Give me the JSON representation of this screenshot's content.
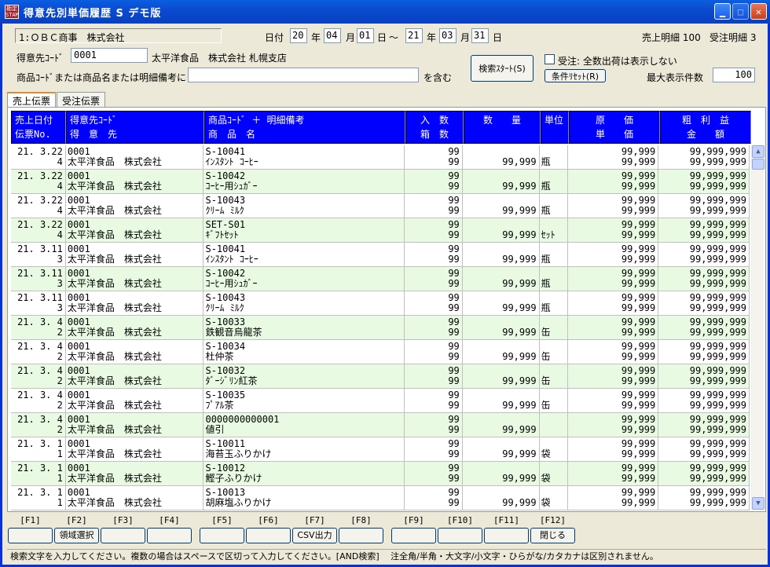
{
  "window": {
    "title": "得意先別単価履歴 S デモ版",
    "icon_text": "勘定 STAMP"
  },
  "header": {
    "company": "1:ＯＢＣ商事　株式会社",
    "date_label": "日付",
    "from_year": "20",
    "year_label": "年",
    "from_month": "04",
    "month_label": "月",
    "from_day": "01",
    "day_label": "日",
    "tilde": "～",
    "to_year": "21",
    "to_month": "03",
    "to_day": "31",
    "sales_detail": "売上明細 100",
    "order_detail": "受注明細 3",
    "customer_code_label": "得意先ｺｰﾄﾞ",
    "customer_code": "0001",
    "customer_name": "太平洋食品　株式会社 札幌支店",
    "search_label": "商品ｺｰﾄﾞまたは商品名または明細備考に",
    "search_value": "",
    "contains_label": "を含む",
    "search_button": "検索ｽﾀｰﾄ(S)",
    "order_checkbox_label": "受注: 全数出荷は表示しない",
    "reset_button": "条件ﾘｾｯﾄ(R)",
    "max_label": "最大表示件数",
    "max_value": "100"
  },
  "tabs": [
    "売上伝票",
    "受注伝票"
  ],
  "columns": [
    {
      "l1": "売上日付",
      "l2": "伝票No."
    },
    {
      "l1": "得意先ｺｰﾄﾞ",
      "l2": "得　意　先"
    },
    {
      "l1": "商品ｺｰﾄﾞ ＋ 明細備考",
      "l2": "商　品　名"
    },
    {
      "l1": "入　数",
      "l2": "箱　数"
    },
    {
      "l1": "",
      "l2": "数　　量"
    },
    {
      "l1": "",
      "l2": "単位"
    },
    {
      "l1": "原　　価",
      "l2": "単　　価"
    },
    {
      "l1": "粗　利　益",
      "l2": "金　　額"
    }
  ],
  "rows": [
    {
      "date": "21. 3.22",
      "no": "4",
      "code": "0001",
      "cust": "太平洋食品　株式会社",
      "pcode": "S-10041",
      "pname": "ｲﾝｽﾀﾝﾄ ｺｰﾋｰ",
      "irisu": "99",
      "hako": "99",
      "qty": "99,999",
      "unit": "瓶",
      "cost": "99,999",
      "price": "99,999",
      "profit": "99,999,999",
      "amount": "99,999,999"
    },
    {
      "date": "21. 3.22",
      "no": "4",
      "code": "0001",
      "cust": "太平洋食品　株式会社",
      "pcode": "S-10042",
      "pname": "ｺｰﾋｰ用ｼｭｶﾞｰ",
      "irisu": "99",
      "hako": "99",
      "qty": "99,999",
      "unit": "瓶",
      "cost": "99,999",
      "price": "99,999",
      "profit": "99,999,999",
      "amount": "99,999,999"
    },
    {
      "date": "21. 3.22",
      "no": "4",
      "code": "0001",
      "cust": "太平洋食品　株式会社",
      "pcode": "S-10043",
      "pname": "ｸﾘｰﾑ ﾐﾙｸ",
      "irisu": "99",
      "hako": "99",
      "qty": "99,999",
      "unit": "瓶",
      "cost": "99,999",
      "price": "99,999",
      "profit": "99,999,999",
      "amount": "99,999,999"
    },
    {
      "date": "21. 3.22",
      "no": "4",
      "code": "0001",
      "cust": "太平洋食品　株式会社",
      "pcode": "SET-S01",
      "pname": "ｷﾞﾌﾄｾｯﾄ",
      "irisu": "99",
      "hako": "99",
      "qty": "99,999",
      "unit": "ｾｯﾄ",
      "cost": "99,999",
      "price": "99,999",
      "profit": "99,999,999",
      "amount": "99,999,999"
    },
    {
      "date": "21. 3.11",
      "no": "3",
      "code": "0001",
      "cust": "太平洋食品　株式会社",
      "pcode": "S-10041",
      "pname": "ｲﾝｽﾀﾝﾄ ｺｰﾋｰ",
      "irisu": "99",
      "hako": "99",
      "qty": "99,999",
      "unit": "瓶",
      "cost": "99,999",
      "price": "99,999",
      "profit": "99,999,999",
      "amount": "99,999,999"
    },
    {
      "date": "21. 3.11",
      "no": "3",
      "code": "0001",
      "cust": "太平洋食品　株式会社",
      "pcode": "S-10042",
      "pname": "ｺｰﾋｰ用ｼｭｶﾞｰ",
      "irisu": "99",
      "hako": "99",
      "qty": "99,999",
      "unit": "瓶",
      "cost": "99,999",
      "price": "99,999",
      "profit": "99,999,999",
      "amount": "99,999,999"
    },
    {
      "date": "21. 3.11",
      "no": "3",
      "code": "0001",
      "cust": "太平洋食品　株式会社",
      "pcode": "S-10043",
      "pname": "ｸﾘｰﾑ ﾐﾙｸ",
      "irisu": "99",
      "hako": "99",
      "qty": "99,999",
      "unit": "瓶",
      "cost": "99,999",
      "price": "99,999",
      "profit": "99,999,999",
      "amount": "99,999,999"
    },
    {
      "date": "21. 3. 4",
      "no": "2",
      "code": "0001",
      "cust": "太平洋食品　株式会社",
      "pcode": "S-10033",
      "pname": "鉄観音烏龍茶",
      "irisu": "99",
      "hako": "99",
      "qty": "99,999",
      "unit": "缶",
      "cost": "99,999",
      "price": "99,999",
      "profit": "99,999,999",
      "amount": "99,999,999"
    },
    {
      "date": "21. 3. 4",
      "no": "2",
      "code": "0001",
      "cust": "太平洋食品　株式会社",
      "pcode": "S-10034",
      "pname": "杜仲茶",
      "irisu": "99",
      "hako": "99",
      "qty": "99,999",
      "unit": "缶",
      "cost": "99,999",
      "price": "99,999",
      "profit": "99,999,999",
      "amount": "99,999,999"
    },
    {
      "date": "21. 3. 4",
      "no": "2",
      "code": "0001",
      "cust": "太平洋食品　株式会社",
      "pcode": "S-10032",
      "pname": "ﾀﾞｰｼﾞﾘﾝ紅茶",
      "irisu": "99",
      "hako": "99",
      "qty": "99,999",
      "unit": "缶",
      "cost": "99,999",
      "price": "99,999",
      "profit": "99,999,999",
      "amount": "99,999,999"
    },
    {
      "date": "21. 3. 4",
      "no": "2",
      "code": "0001",
      "cust": "太平洋食品　株式会社",
      "pcode": "S-10035",
      "pname": "ﾌﾟｱﾙ茶",
      "irisu": "99",
      "hako": "99",
      "qty": "99,999",
      "unit": "缶",
      "cost": "99,999",
      "price": "99,999",
      "profit": "99,999,999",
      "amount": "99,999,999"
    },
    {
      "date": "21. 3. 4",
      "no": "2",
      "code": "0001",
      "cust": "太平洋食品　株式会社",
      "pcode": "0000000000001",
      "pname": "値引",
      "irisu": "99",
      "hako": "99",
      "qty": "99,999",
      "unit": "",
      "cost": "99,999",
      "price": "99,999",
      "profit": "99,999,999",
      "amount": "99,999,999"
    },
    {
      "date": "21. 3. 1",
      "no": "1",
      "code": "0001",
      "cust": "太平洋食品　株式会社",
      "pcode": "S-10011",
      "pname": "海苔玉ふりかけ",
      "irisu": "99",
      "hako": "99",
      "qty": "99,999",
      "unit": "袋",
      "cost": "99,999",
      "price": "99,999",
      "profit": "99,999,999",
      "amount": "99,999,999"
    },
    {
      "date": "21. 3. 1",
      "no": "1",
      "code": "0001",
      "cust": "太平洋食品　株式会社",
      "pcode": "S-10012",
      "pname": "鰹子ふりかけ",
      "irisu": "99",
      "hako": "99",
      "qty": "99,999",
      "unit": "袋",
      "cost": "99,999",
      "price": "99,999",
      "profit": "99,999,999",
      "amount": "99,999,999"
    },
    {
      "date": "21. 3. 1",
      "no": "1",
      "code": "0001",
      "cust": "太平洋食品　株式会社",
      "pcode": "S-10013",
      "pname": "胡麻塩ふりかけ",
      "irisu": "99",
      "hako": "99",
      "qty": "99,999",
      "unit": "袋",
      "cost": "99,999",
      "price": "99,999",
      "profit": "99,999,999",
      "amount": "99,999,999"
    }
  ],
  "fkeys": [
    {
      "key": "[F1]",
      "label": ""
    },
    {
      "key": "[F2]",
      "label": "領域選択"
    },
    {
      "key": "[F3]",
      "label": ""
    },
    {
      "key": "[F4]",
      "label": ""
    },
    {
      "key": "[F5]",
      "label": ""
    },
    {
      "key": "[F6]",
      "label": ""
    },
    {
      "key": "[F7]",
      "label": "CSV出力"
    },
    {
      "key": "[F8]",
      "label": ""
    },
    {
      "key": "[F9]",
      "label": ""
    },
    {
      "key": "[F10]",
      "label": ""
    },
    {
      "key": "[F11]",
      "label": ""
    },
    {
      "key": "[F12]",
      "label": "閉じる"
    }
  ],
  "status": "検索文字を入力してください。複数の場合はスペースで区切って入力してください。[AND検索]　 注全角/半角・大文字/小文字・ひらがな/カタカナは区別されません。",
  "colors": {
    "header_bg": "#0000ff",
    "alt_row": "#e8fbe2",
    "titlebar": "#0a5fe0"
  }
}
